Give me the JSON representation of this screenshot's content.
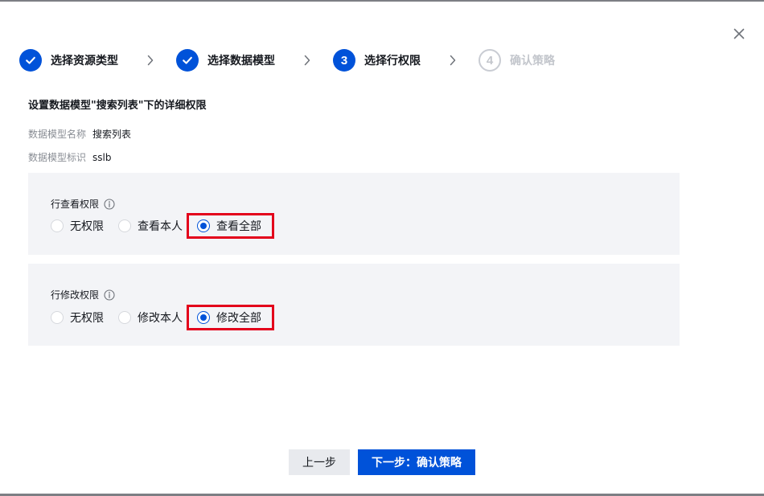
{
  "stepper": {
    "steps": [
      {
        "label": "选择资源类型",
        "state": "done"
      },
      {
        "label": "选择数据模型",
        "state": "done"
      },
      {
        "label": "选择行权限",
        "state": "current",
        "number": "3"
      },
      {
        "label": "确认策略",
        "state": "pending",
        "number": "4"
      }
    ]
  },
  "section": {
    "title": "设置数据模型\"搜索列表\"下的详细权限"
  },
  "model": {
    "name_label": "数据模型名称",
    "name_value": "搜索列表",
    "id_label": "数据模型标识",
    "id_value": "sslb"
  },
  "view_permission": {
    "title": "行查看权限",
    "options": [
      "无权限",
      "查看本人",
      "查看全部"
    ],
    "selected": "查看全部"
  },
  "edit_permission": {
    "title": "行修改权限",
    "options": [
      "无权限",
      "修改本人",
      "修改全部"
    ],
    "selected": "修改全部"
  },
  "footer": {
    "prev_label": "上一步",
    "next_label": "下一步：确认策略"
  },
  "colors": {
    "primary": "#0052d9",
    "highlight": "#e3001b",
    "panel_bg": "#f3f4f7",
    "pending": "#c3c6cc"
  },
  "icons": {
    "close": "close-icon",
    "step_done": "check-icon",
    "step_separator": "chevron-right-icon",
    "info": "info-icon"
  }
}
